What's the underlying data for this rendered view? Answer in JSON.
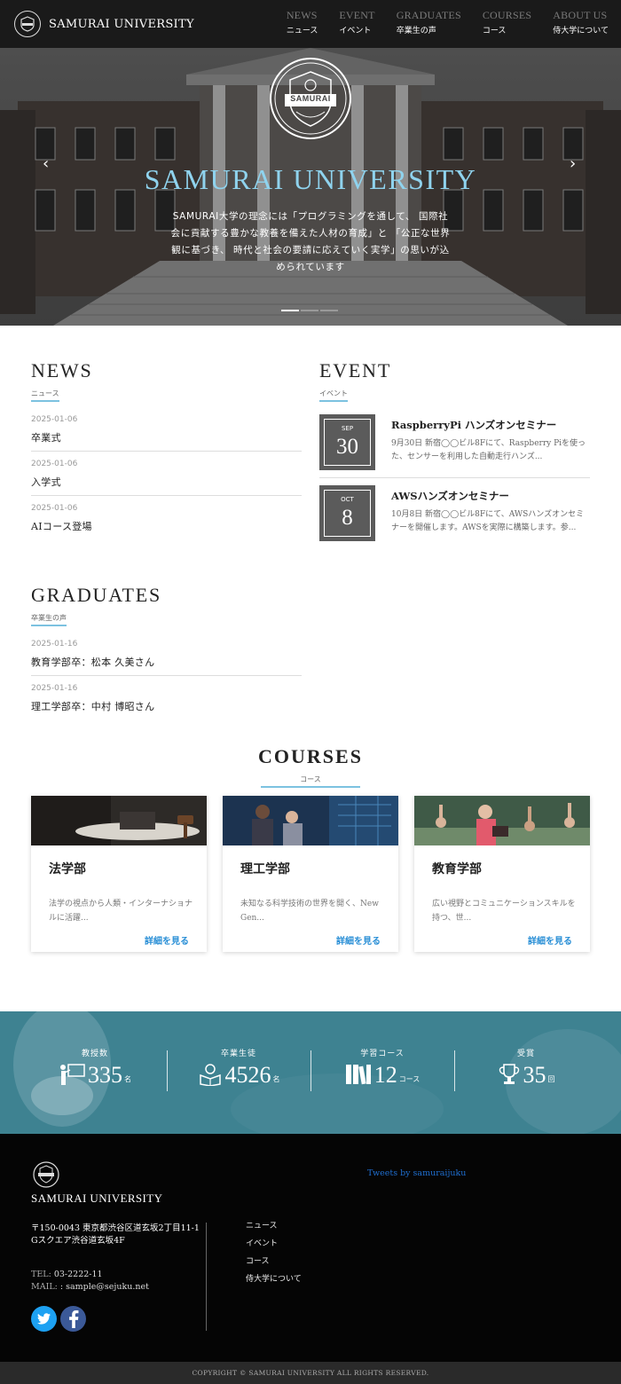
{
  "header": {
    "logo_text": "SAMURAI UNIVERSITY",
    "nav": [
      {
        "en": "NEWS",
        "jp": "ニュース"
      },
      {
        "en": "EVENT",
        "jp": "イベント"
      },
      {
        "en": "GRADUATES",
        "jp": "卒業生の声"
      },
      {
        "en": "COURSES",
        "jp": "コース"
      },
      {
        "en": "ABOUT US",
        "jp": "侍大学について"
      }
    ]
  },
  "hero": {
    "emblem_text": "SAMURAI",
    "title": "SAMURAI UNIVERSITY",
    "description": "SAMURAI大学の理念には「プログラミングを通して、 国際社会に貢献する豊かな教養を備えた人材の育成」と 「公正な世界観に基づき、 時代と社会の要請に応えていく実学」の思いが込められています",
    "prev_icon": "chevron-left-icon",
    "next_icon": "chevron-right-icon",
    "active_slide": 1,
    "slide_count": 3
  },
  "news": {
    "title": "NEWS",
    "subtitle": "ニュース",
    "items": [
      {
        "date": "2025-01-06",
        "title": "卒業式"
      },
      {
        "date": "2025-01-06",
        "title": "入学式"
      },
      {
        "date": "2025-01-06",
        "title": "AIコース登場"
      }
    ]
  },
  "event": {
    "title": "EVENT",
    "subtitle": "イベント",
    "items": [
      {
        "month": "SEP",
        "day": "30",
        "title": "RaspberryPi ハンズオンセミナー",
        "desc": "9月30日 新宿◯◯ビル8Fにて、Raspberry Piを使った、センサーを利用した自動走行ハンズ..."
      },
      {
        "month": "OCT",
        "day": "8",
        "title": "AWSハンズオンセミナー",
        "desc": "10月8日 新宿◯◯ビル8Fにて、AWSハンズオンセミナーを開催します。AWSを実際に構築します。参..."
      }
    ]
  },
  "graduates": {
    "title": "GRADUATES",
    "subtitle": "卒業生の声",
    "items": [
      {
        "date": "2025-01-16",
        "title": "教育学部卒：松本 久美さん"
      },
      {
        "date": "2025-01-16",
        "title": "理工学部卒：中村 博昭さん"
      }
    ]
  },
  "courses": {
    "title": "COURSES",
    "subtitle": "コース",
    "items": [
      {
        "title": "法学部",
        "desc": "法学の視点から人類・インターナショナルに活躍...",
        "link": "詳細を見る"
      },
      {
        "title": "理工学部",
        "desc": "未知なる科学技術の世界を開く、New Gen...",
        "link": "詳細を見る"
      },
      {
        "title": "教育学部",
        "desc": "広い視野とコミュニケーションスキルを持つ、世...",
        "link": "詳細を見る"
      }
    ]
  },
  "stats": [
    {
      "label": "教授数",
      "value": "335",
      "unit": "名",
      "icon": "teacher-icon"
    },
    {
      "label": "卒業生徒",
      "value": "4526",
      "unit": "名",
      "icon": "student-icon"
    },
    {
      "label": "学習コース",
      "value": "12",
      "unit": "コース",
      "icon": "books-icon"
    },
    {
      "label": "受賞",
      "value": "35",
      "unit": "回",
      "icon": "trophy-icon"
    }
  ],
  "footer": {
    "name": "SAMURAI UNIVERSITY",
    "address": "〒150-0043 東京都渋谷区道玄坂2丁目11-1 Gスクエア渋谷道玄坂4F",
    "tel_label": "TEL:",
    "tel": "03-2222-11",
    "mail_label": "MAIL:",
    "mail": ": sample@sejuku.net",
    "links": [
      "ニュース",
      "イベント",
      "コース",
      "侍大学について"
    ],
    "tweets": "Tweets by samuraijuku",
    "copyright": "COPYRIGHT © SAMURAI UNIVERSITY ALL RIGHTS RESERVED."
  },
  "colors": {
    "accent": "#7cc2e0",
    "hero_title": "#8fd3ee",
    "link": "#2a8fd6",
    "stats_bg": "#3e8291",
    "twitter": "#1da1f2",
    "facebook": "#3b5998"
  }
}
